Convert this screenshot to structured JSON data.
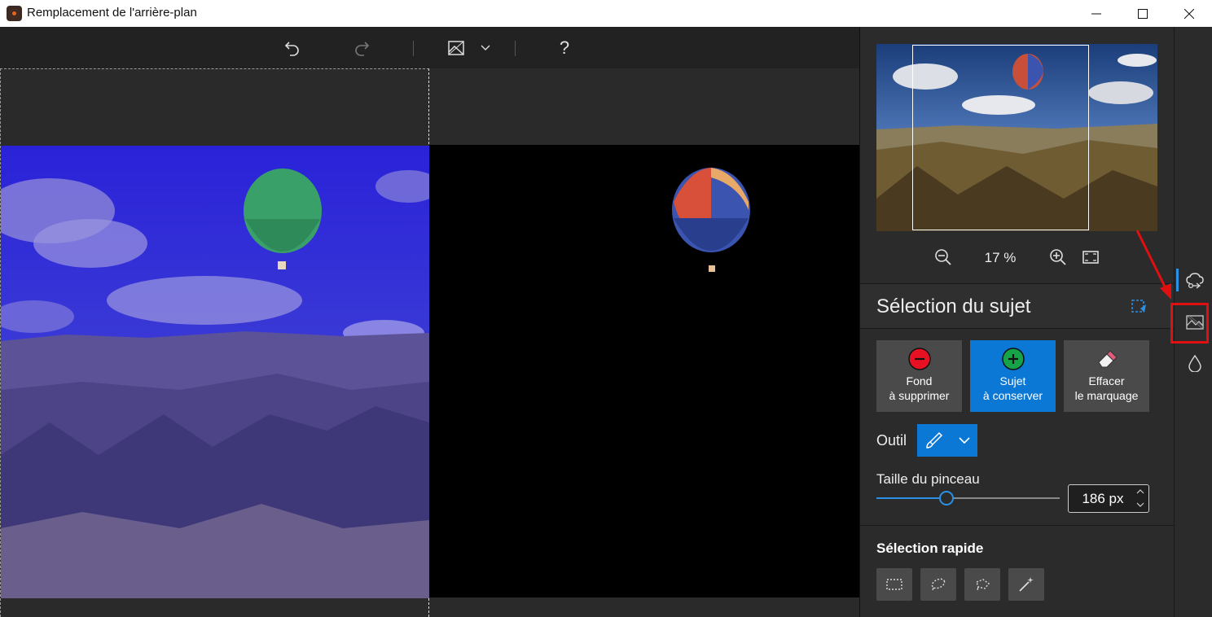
{
  "window": {
    "title": "Remplacement de l'arrière-plan",
    "controls": [
      "minimize",
      "maximize",
      "close"
    ]
  },
  "toolbar": {
    "items": [
      "undo-icon",
      "redo-icon",
      "view-mode-icon",
      "chevron-down-icon",
      "help"
    ],
    "help_label": "?"
  },
  "preview": {
    "zoom_value": "17 %"
  },
  "subject_selection": {
    "title": "Sélection du sujet",
    "modes": [
      {
        "line1": "Fond",
        "line2": "à supprimer",
        "icon": "minus-circle-icon",
        "color": "#e81123",
        "active": false
      },
      {
        "line1": "Sujet",
        "line2": "à conserver",
        "icon": "plus-circle-icon",
        "color": "#16a34a",
        "active": true
      },
      {
        "line1": "Effacer",
        "line2": "le marquage",
        "icon": "eraser-icon",
        "active": false
      }
    ],
    "tool_label": "Outil",
    "brush_size_label": "Taille du pinceau",
    "brush_size_value": "186 px",
    "brush_size_fraction": 0.38
  },
  "quick_selection": {
    "title": "Sélection rapide",
    "tools": [
      "rectangle-select-icon",
      "ellipse-lasso-icon",
      "polygon-lasso-icon",
      "magic-wand-icon"
    ]
  },
  "rail": {
    "items": [
      "replace-background-icon",
      "scene-icon",
      "drop-icon"
    ]
  },
  "colors": {
    "accent": "#0a78d4",
    "highlight": "#e01010"
  }
}
